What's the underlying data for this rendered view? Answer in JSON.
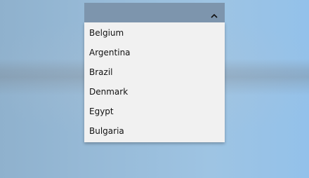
{
  "combobox": {
    "expanded_icon": "chevron-up-icon",
    "options": [
      {
        "label": "Belgium"
      },
      {
        "label": "Argentina"
      },
      {
        "label": "Brazil"
      },
      {
        "label": "Denmark"
      },
      {
        "label": "Egypt"
      },
      {
        "label": "Bulgaria"
      }
    ]
  },
  "colors": {
    "header_bg": "#7d95ad",
    "dropdown_bg": "#f1f1f1",
    "text": "#111111"
  }
}
